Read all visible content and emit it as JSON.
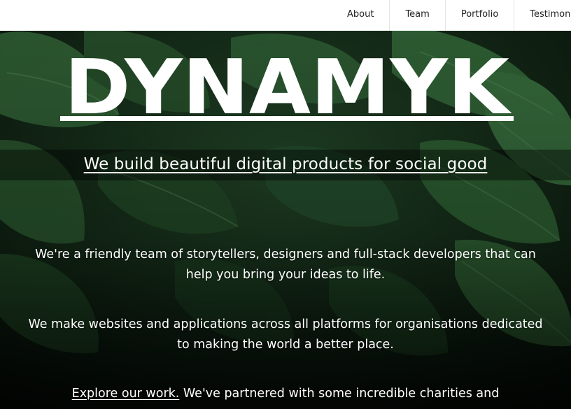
{
  "nav": {
    "items": [
      {
        "label": "About"
      },
      {
        "label": "Team"
      },
      {
        "label": "Portfolio"
      },
      {
        "label": "Testimonials"
      }
    ]
  },
  "hero": {
    "logo_text": "DYNAMYK",
    "tagline": "We build beautiful digital products for social good",
    "paragraph1": "We're a friendly team of storytellers, designers and full-stack developers that can help you bring your ideas to life.",
    "paragraph2": "We make websites and applications across all platforms for organisations dedicated to making the world a better place.",
    "paragraph3_link": "Explore our work.",
    "paragraph3_text": " We've partnered with some incredible charities and"
  },
  "colors": {
    "nav_background": "#ffffff",
    "nav_text": "#222222",
    "hero_text": "#ffffff",
    "foliage_dark": "#0b1a0e",
    "foliage_light": "#2f5a32"
  },
  "icons": {
    "background": "monstera-leaves-image"
  }
}
